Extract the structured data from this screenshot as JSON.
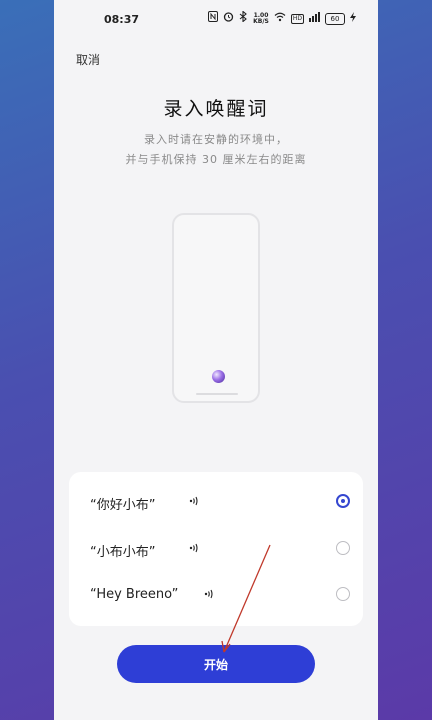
{
  "status_bar": {
    "time": "08:37",
    "icons": [
      "nfc-icon",
      "alarm-icon",
      "bluetooth-icon",
      "network-speed-icon",
      "wifi-icon",
      "hd-icon",
      "signal-icon",
      "battery-icon",
      "charging-icon"
    ],
    "network_speed_value": "1.00",
    "network_speed_unit": "KB/S",
    "hd_label": "HD",
    "battery_level": "60"
  },
  "header": {
    "cancel_label": "取消",
    "title": "录入唤醒词",
    "subtitle_line1": "录入时请在安静的环境中，",
    "subtitle_line2": "并与手机保持 30 厘米左右的距离"
  },
  "options": [
    {
      "label": "“你好小布”",
      "selected": true
    },
    {
      "label": "“小布小布”",
      "selected": false
    },
    {
      "label": "“Hey Breeno”",
      "selected": false
    }
  ],
  "start_button_label": "开始",
  "colors": {
    "accent": "#2e3ed6",
    "background_gradient_top": "#3a6fb8",
    "background_gradient_bottom": "#5b3aa8",
    "annotation_arrow": "#c0392b"
  }
}
